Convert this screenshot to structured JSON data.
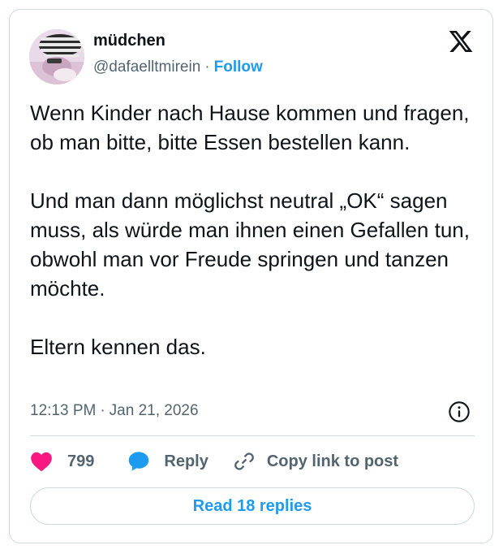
{
  "author": {
    "display_name": "müdchen",
    "handle": "@dafaelltmirein",
    "separator": "·",
    "follow_label": "Follow"
  },
  "tweet": {
    "paragraphs": [
      "Wenn Kinder nach Hause kommen und fragen, ob man bitte, bitte Essen bestellen kann.",
      "Und man dann möglichst neutral „OK“ sagen muss, als würde man ihnen einen Gefallen tun, obwohl man vor Freude springen und tanzen möchte.",
      "Eltern kennen das."
    ],
    "time": "12:13 PM",
    "separator": "·",
    "date": "Jan 21, 2026"
  },
  "actions": {
    "like_count": "799",
    "reply_label": "Reply",
    "copy_link_label": "Copy link to post",
    "read_replies_label": "Read 18 replies"
  },
  "icons": {
    "brand": "x-logo-icon",
    "info": "info-icon",
    "like": "heart-icon",
    "reply": "speech-bubble-icon",
    "copy": "link-icon"
  },
  "colors": {
    "accent": "#1d9bf0",
    "like": "#f91880",
    "text": "#0f1419",
    "secondary": "#536471",
    "border": "#cfd9de"
  }
}
